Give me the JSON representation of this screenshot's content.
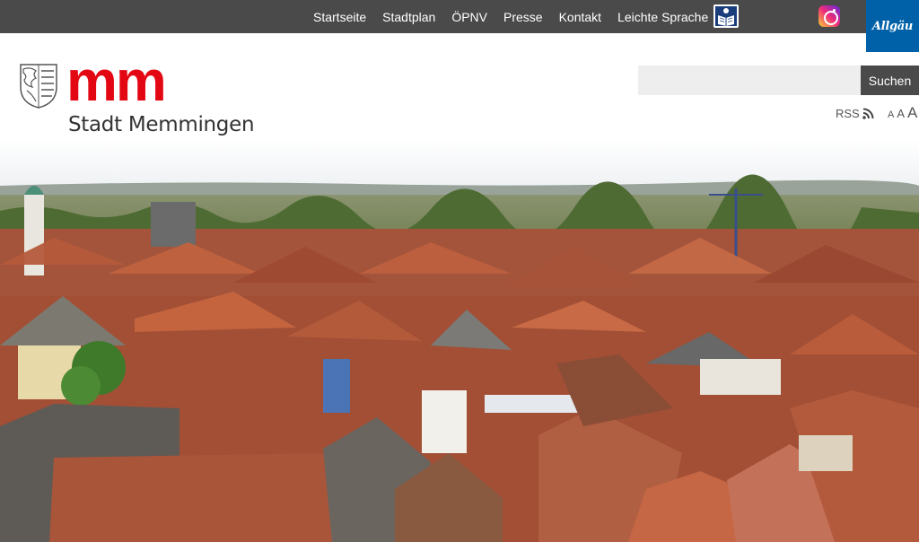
{
  "topnav": {
    "items": [
      "Startseite",
      "Stadtplan",
      "ÖPNV",
      "Presse",
      "Kontakt",
      "Leichte Sprache"
    ]
  },
  "icons": {
    "easy_language": "easy-language-book-icon",
    "instagram": "instagram-icon"
  },
  "allgaeu": {
    "label": "Allgäu"
  },
  "logo": {
    "mark": "mm",
    "city": "Stadt Memmingen"
  },
  "search": {
    "value": "",
    "placeholder": "",
    "button": "Suchen"
  },
  "rss": {
    "label": "RSS"
  },
  "font_size": {
    "small": "A",
    "medium": "A",
    "large": "A"
  },
  "colors": {
    "brand_red": "#e30613",
    "bar": "#4a4a4a",
    "allgaeu_blue": "#0061a8"
  }
}
